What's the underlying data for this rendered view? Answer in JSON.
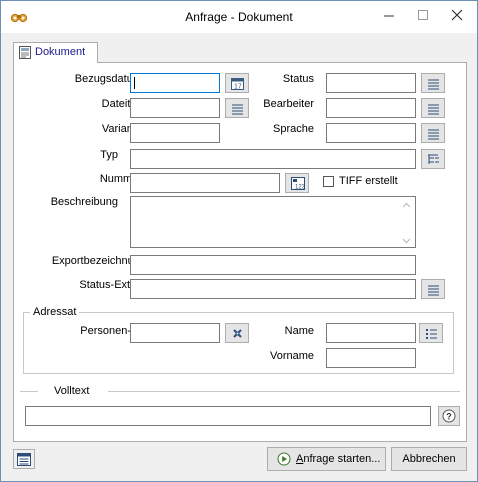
{
  "window": {
    "title": "Anfrage - Dokument"
  },
  "tab": {
    "label": "Dokument"
  },
  "form": {
    "bezugsdatum": {
      "label": "Bezugsdatum",
      "value": ""
    },
    "status": {
      "label": "Status",
      "value": ""
    },
    "dateityp": {
      "label": "Dateityp",
      "value": ""
    },
    "bearbeiter": {
      "label": "Bearbeiter",
      "value": ""
    },
    "variante": {
      "label": "Variante",
      "value": ""
    },
    "sprache": {
      "label": "Sprache",
      "value": ""
    },
    "typ": {
      "label": "Typ",
      "value": ""
    },
    "nummer": {
      "label": "Nummer",
      "value": ""
    },
    "tiff": {
      "label": "TIFF erstellt",
      "checked": false
    },
    "beschreibung": {
      "label": "Beschreibung",
      "value": ""
    },
    "exportbezeichnung": {
      "label": "Exportbezeichnung",
      "value": ""
    },
    "status_extern": {
      "label": "Status-Extern",
      "value": ""
    }
  },
  "adressat": {
    "legend": "Adressat",
    "personen_id": {
      "label": "Personen-ID",
      "value": ""
    },
    "name": {
      "label": "Name",
      "value": ""
    },
    "vorname": {
      "label": "Vorname",
      "value": ""
    }
  },
  "volltext": {
    "label": "Volltext",
    "value": ""
  },
  "footer": {
    "start_label_accel": "A",
    "start_label_rest": "nfrage starten...",
    "cancel_label": "Abbrechen"
  },
  "icons": {
    "app": "binoculars-icon",
    "calendar": "calendar-icon",
    "list": "list-icon",
    "tree": "tree-icon",
    "numbering": "numbering-icon",
    "details": "details-list-icon",
    "pick": "tools-icon",
    "help": "question-icon",
    "play": "play-icon",
    "form": "form-icon"
  },
  "colors": {
    "accent": "#0078d7",
    "title_text": "#000000",
    "tab_text": "#1a1a8a",
    "app_icon": "#e8a33a"
  }
}
